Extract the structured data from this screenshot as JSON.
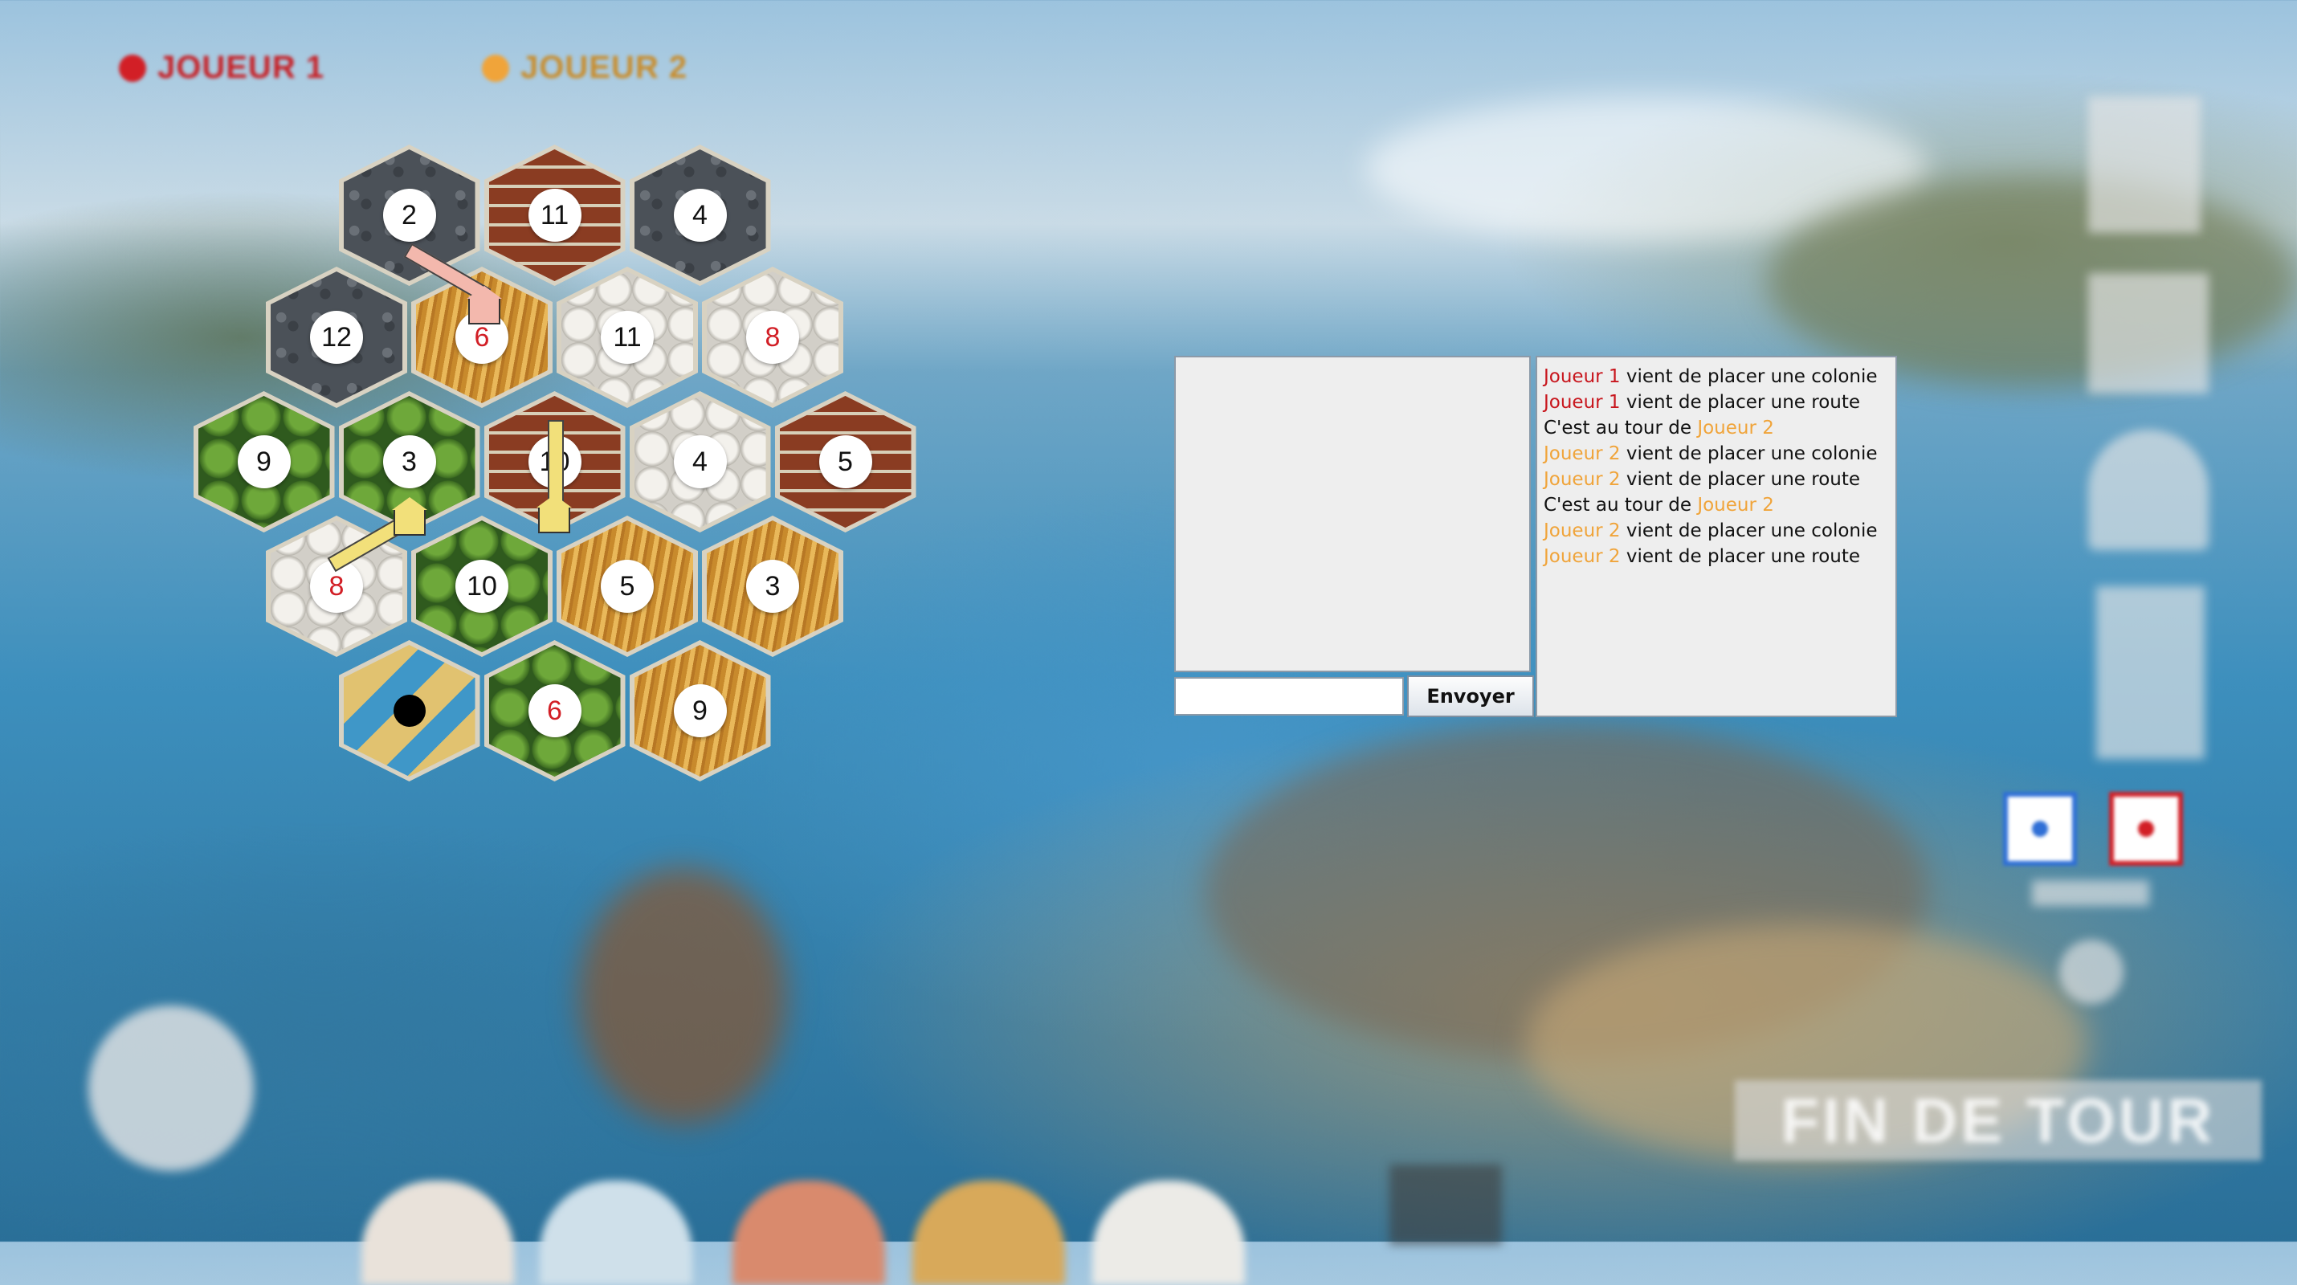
{
  "players": [
    {
      "name": "JOUEUR 1",
      "color": "#d21f26"
    },
    {
      "name": "JOUEUR 2",
      "color": "#f0a43a"
    }
  ],
  "board": {
    "tiles": [
      {
        "row": 0,
        "col": 0,
        "terrain": "ore",
        "number": "2"
      },
      {
        "row": 0,
        "col": 1,
        "terrain": "brick",
        "number": "11"
      },
      {
        "row": 0,
        "col": 2,
        "terrain": "ore",
        "number": "4"
      },
      {
        "row": 1,
        "col": 0,
        "terrain": "ore",
        "number": "12"
      },
      {
        "row": 1,
        "col": 1,
        "terrain": "wheat",
        "number": "6"
      },
      {
        "row": 1,
        "col": 2,
        "terrain": "wool",
        "number": "11"
      },
      {
        "row": 1,
        "col": 3,
        "terrain": "wool",
        "number": "8"
      },
      {
        "row": 2,
        "col": 0,
        "terrain": "wood",
        "number": "9"
      },
      {
        "row": 2,
        "col": 1,
        "terrain": "wood",
        "number": "3"
      },
      {
        "row": 2,
        "col": 2,
        "terrain": "brick",
        "number": "10"
      },
      {
        "row": 2,
        "col": 3,
        "terrain": "wool",
        "number": "4"
      },
      {
        "row": 2,
        "col": 4,
        "terrain": "brick",
        "number": "5"
      },
      {
        "row": 3,
        "col": 0,
        "terrain": "wool",
        "number": "8"
      },
      {
        "row": 3,
        "col": 1,
        "terrain": "wood",
        "number": "10"
      },
      {
        "row": 3,
        "col": 2,
        "terrain": "wheat",
        "number": "5"
      },
      {
        "row": 3,
        "col": 3,
        "terrain": "wheat",
        "number": "3"
      },
      {
        "row": 4,
        "col": 0,
        "terrain": "desert",
        "number": ""
      },
      {
        "row": 4,
        "col": 1,
        "terrain": "wood",
        "number": "6"
      },
      {
        "row": 4,
        "col": 2,
        "terrain": "wheat",
        "number": "9"
      }
    ],
    "hot_color": "#d21f26"
  },
  "chat": {
    "input_value": "",
    "send_label": "Envoyer",
    "log": [
      [
        {
          "t": "Joueur 1",
          "c": "p1"
        },
        {
          "t": " vient de placer une colonie",
          "c": ""
        }
      ],
      [
        {
          "t": "Joueur 1",
          "c": "p1"
        },
        {
          "t": " vient de placer une route",
          "c": ""
        }
      ],
      [
        {
          "t": "C'est au tour de ",
          "c": ""
        },
        {
          "t": "Joueur 2",
          "c": "p2"
        }
      ],
      [
        {
          "t": "Joueur 2",
          "c": "p2"
        },
        {
          "t": " vient de placer une colonie",
          "c": ""
        }
      ],
      [
        {
          "t": "Joueur 2",
          "c": "p2"
        },
        {
          "t": " vient de placer une route",
          "c": ""
        }
      ],
      [
        {
          "t": "C'est au tour de ",
          "c": ""
        },
        {
          "t": "Joueur 2",
          "c": "p2"
        }
      ],
      [
        {
          "t": "Joueur 2",
          "c": "p2"
        },
        {
          "t": " vient de placer une colonie",
          "c": ""
        }
      ],
      [
        {
          "t": "Joueur 2",
          "c": "p2"
        },
        {
          "t": " vient de placer une route",
          "c": ""
        }
      ]
    ]
  },
  "controls": {
    "end_turn_label": "FIN DE TOUR",
    "dice_colors": [
      "#2f6fd6",
      "#d21f26"
    ]
  }
}
